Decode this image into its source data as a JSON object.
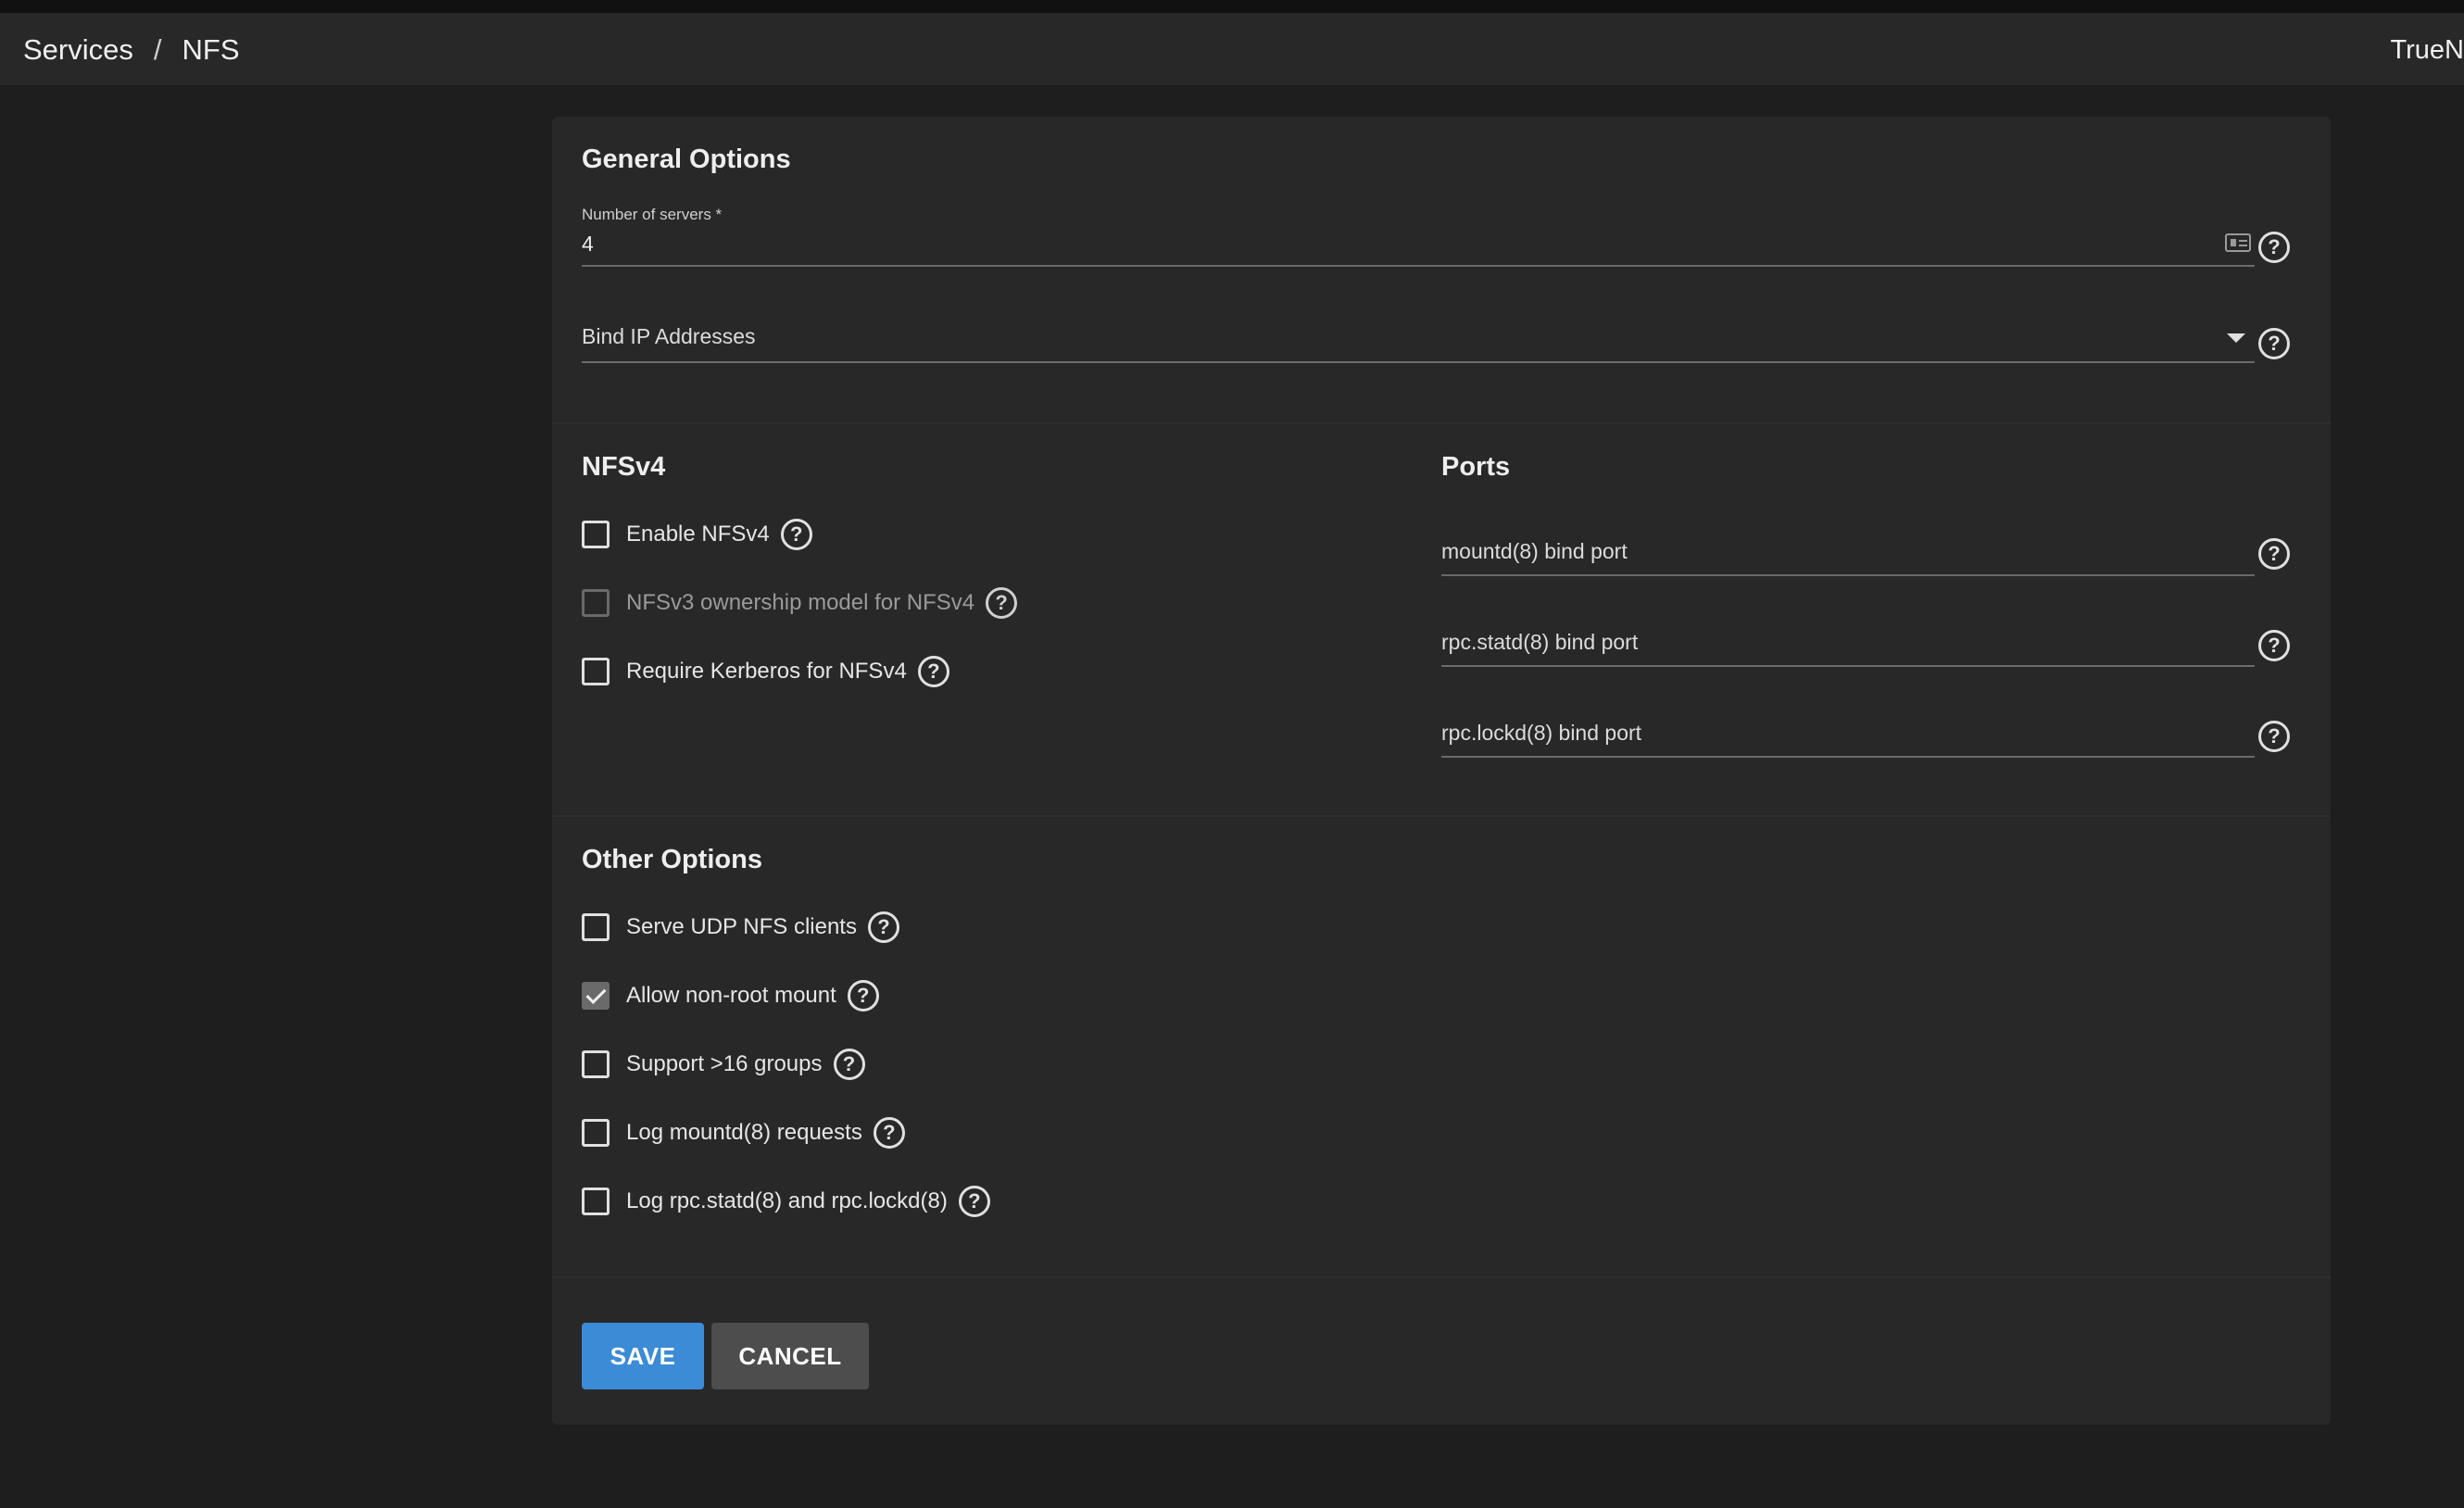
{
  "breadcrumb": {
    "parent": "Services",
    "separator": "/",
    "current": "NFS"
  },
  "brand": "TrueN",
  "general": {
    "title": "General Options",
    "servers_label": "Number of servers *",
    "servers_value": "4",
    "bind_ip_label": "Bind IP Addresses"
  },
  "nfsv4": {
    "title": "NFSv4",
    "items": [
      {
        "label": "Enable NFSv4",
        "checked": false,
        "disabled": false
      },
      {
        "label": "NFSv3 ownership model for NFSv4",
        "checked": false,
        "disabled": true
      },
      {
        "label": "Require Kerberos for NFSv4",
        "checked": false,
        "disabled": false
      }
    ]
  },
  "ports": {
    "title": "Ports",
    "mountd": "mountd(8) bind port",
    "statd": "rpc.statd(8) bind port",
    "lockd": "rpc.lockd(8) bind port"
  },
  "other": {
    "title": "Other Options",
    "items": [
      {
        "label": "Serve UDP NFS clients",
        "checked": false
      },
      {
        "label": "Allow non-root mount",
        "checked": true
      },
      {
        "label": "Support >16 groups",
        "checked": false
      },
      {
        "label": "Log mountd(8) requests",
        "checked": false
      },
      {
        "label": "Log rpc.statd(8) and rpc.lockd(8)",
        "checked": false
      }
    ]
  },
  "actions": {
    "save": "SAVE",
    "cancel": "CANCEL"
  },
  "help_glyph": "?"
}
